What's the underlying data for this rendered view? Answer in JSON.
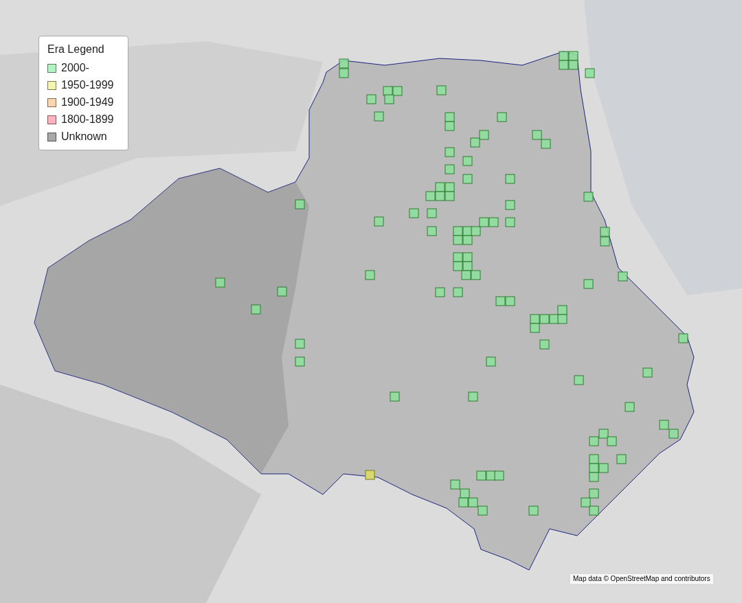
{
  "legend": {
    "title": "Era Legend",
    "items": [
      {
        "label": "2000-",
        "color": "#b3f5c2"
      },
      {
        "label": "1950-1999",
        "color": "#f5f5b0"
      },
      {
        "label": "1900-1949",
        "color": "#ffd5b0"
      },
      {
        "label": "1800-1899",
        "color": "#ffb3bf"
      },
      {
        "label": "Unknown",
        "color": "#a8a8a8"
      }
    ]
  },
  "attribution": "Map data © OpenStreetMap and contributors"
}
